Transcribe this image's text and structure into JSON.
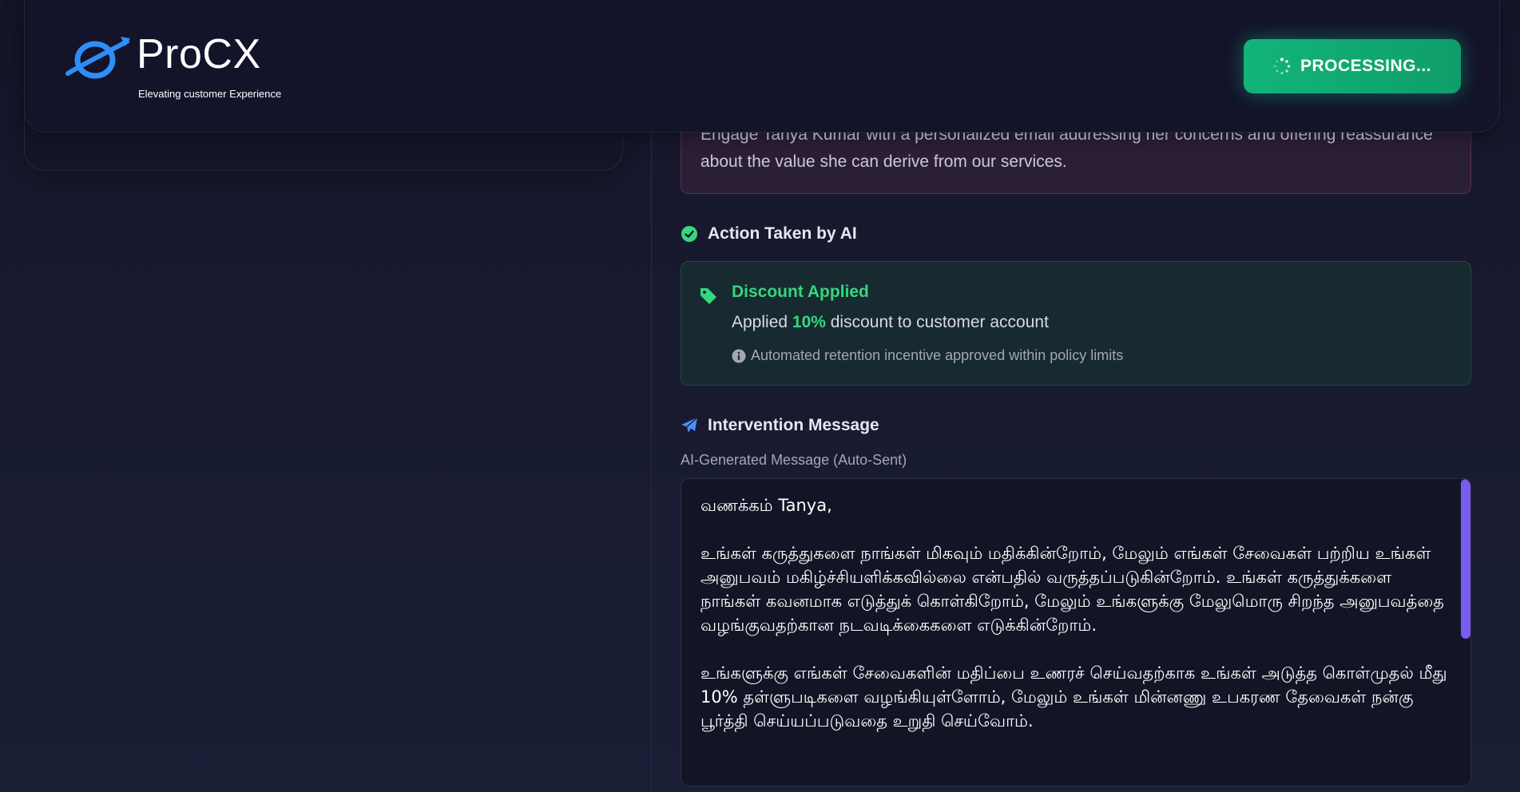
{
  "header": {
    "brand_name": "ProCX",
    "tagline": "Elevating customer Experience",
    "processing_label": "PROCESSING..."
  },
  "recommendation": {
    "text": "Engage Tanya Kumar with a personalized email addressing her concerns and offering reassurance about the value she can derive from our services."
  },
  "action_section": {
    "heading": "Action Taken by AI",
    "discount_title": "Discount Applied",
    "discount_prefix": "Applied ",
    "discount_value": "10%",
    "discount_suffix": " discount to customer account",
    "note": "Automated retention incentive approved within policy limits"
  },
  "intervention": {
    "heading": "Intervention Message",
    "label": "AI-Generated Message (Auto-Sent)",
    "message": "வணக்கம் Tanya,\n\nஉங்கள் கருத்துகளை நாங்கள் மிகவும் மதிக்கின்றோம், மேலும் எங்கள் சேவைகள் பற்றிய உங்கள் அனுபவம் மகிழ்ச்சியளிக்கவில்லை என்பதில் வருத்தப்படுகின்றோம். உங்கள் கருத்துக்களை நாங்கள் கவனமாக எடுத்துக் கொள்கிறோம், மேலும் உங்களுக்கு மேலுமொரு சிறந்த அனுபவத்தை வழங்குவதற்கான நடவடிக்கைகளை எடுக்கின்றோம்.\n\nஉங்களுக்கு எங்கள் சேவைகளின் மதிப்பை உணரச் செய்வதற்காக உங்கள் அடுத்த கொள்முதல் மீது 10% தள்ளுபடிகளை வழங்கியுள்ளோம், மேலும் உங்கள் மின்னணு உபகரண தேவைகள் நன்கு பூர்த்தி செய்யப்படுவதை உறுதி செய்வோம்."
  },
  "colors": {
    "accent_green": "#37d67f",
    "button_green": "#12b479",
    "scrollbar_purple": "#7a5cf0",
    "card_pink_border": "#5c2f4b"
  },
  "icons": [
    "logo-icon",
    "spinner-icon",
    "check-circle-icon",
    "tag-icon",
    "info-icon",
    "paper-plane-icon"
  ]
}
